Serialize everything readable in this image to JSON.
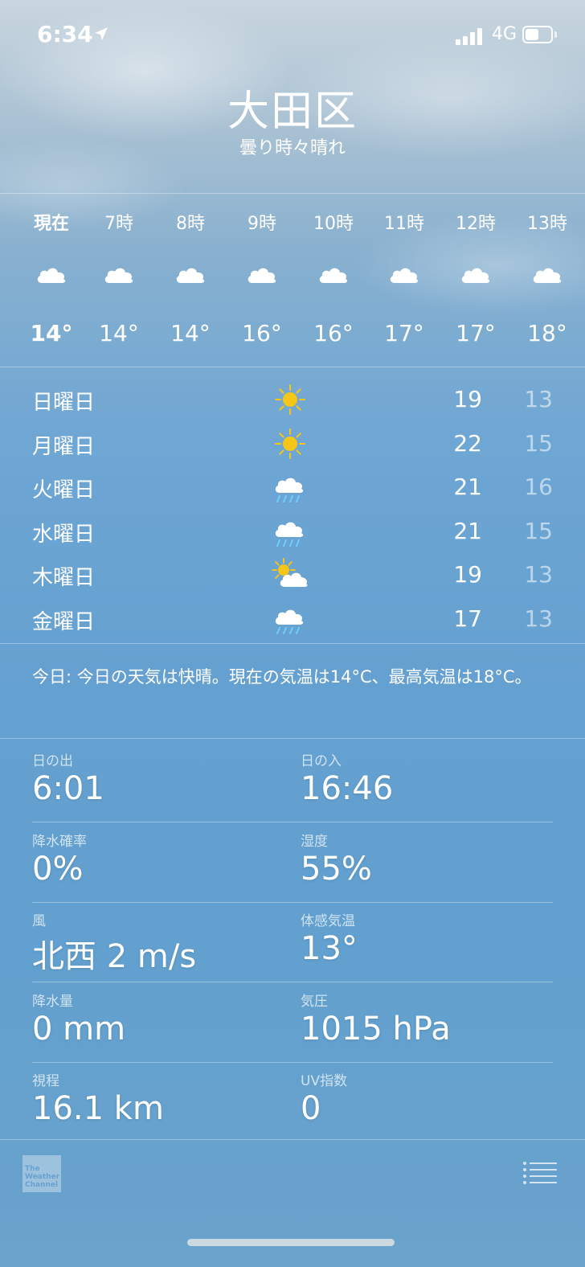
{
  "status_bar": {
    "time": "6:34",
    "network": "4G",
    "battery_level": 0.5
  },
  "location": {
    "city": "大田区",
    "condition": "曇り時々晴れ"
  },
  "hourly": [
    {
      "label": "現在",
      "icon": "cloud-icon",
      "temp": "14°",
      "current": true
    },
    {
      "label": "7時",
      "icon": "cloud-icon",
      "temp": "14°"
    },
    {
      "label": "8時",
      "icon": "cloud-icon",
      "temp": "14°"
    },
    {
      "label": "9時",
      "icon": "cloud-icon",
      "temp": "16°"
    },
    {
      "label": "10時",
      "icon": "cloud-icon",
      "temp": "16°"
    },
    {
      "label": "11時",
      "icon": "cloud-icon",
      "temp": "17°"
    },
    {
      "label": "12時",
      "icon": "cloud-icon",
      "temp": "17°"
    },
    {
      "label": "13時",
      "icon": "cloud-icon",
      "temp": "18°"
    }
  ],
  "daily": [
    {
      "day": "日曜日",
      "icon": "sun-icon",
      "high": "19",
      "low": "13"
    },
    {
      "day": "月曜日",
      "icon": "sun-icon",
      "high": "22",
      "low": "15"
    },
    {
      "day": "火曜日",
      "icon": "rain-cloud-icon",
      "high": "21",
      "low": "16"
    },
    {
      "day": "水曜日",
      "icon": "rain-cloud-icon",
      "high": "21",
      "low": "15"
    },
    {
      "day": "木曜日",
      "icon": "partly-sunny-icon",
      "high": "19",
      "low": "13"
    },
    {
      "day": "金曜日",
      "icon": "rain-cloud-icon",
      "high": "17",
      "low": "13"
    }
  ],
  "summary": "今日: 今日の天気は快晴。現在の気温は14°C、最高気温は18°C。",
  "details": [
    {
      "left_label": "日の出",
      "left_value": "6:01",
      "right_label": "日の入",
      "right_value": "16:46"
    },
    {
      "left_label": "降水確率",
      "left_value": "0%",
      "right_label": "湿度",
      "right_value": "55%"
    },
    {
      "left_label": "風",
      "left_value": "北西 2 m/s",
      "right_label": "体感気温",
      "right_value": "13°"
    },
    {
      "left_label": "降水量",
      "left_value": "0 mm",
      "right_label": "気圧",
      "right_value": "1015 hPa"
    },
    {
      "left_label": "視程",
      "left_value": "16.1 km",
      "right_label": "UV指数",
      "right_value": "0"
    }
  ],
  "footer": {
    "logo_text": "The Weather Channel",
    "list_icon": "list-icon"
  },
  "colors": {
    "sun": "#f5c518",
    "rain": "#6fd0ff",
    "cloud": "#ffffff"
  }
}
